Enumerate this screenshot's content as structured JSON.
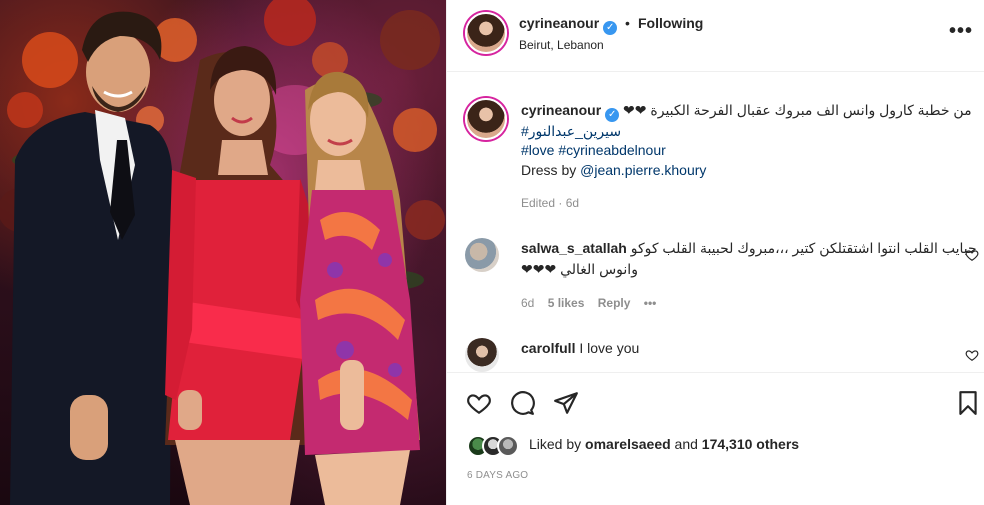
{
  "post": {
    "author": {
      "username": "cyrineanour",
      "location": "Beirut, Lebanon",
      "follow_status": "Following",
      "dot": "•"
    },
    "more_icon": "•••",
    "caption": {
      "text": "من خطبة كارول وانس الف مبروك عقبال الفرحة الكبيرة",
      "hearts": "❤❤",
      "hashtag_ar": "#سيرين_عبدالنور",
      "hashtag_love": "#love",
      "hashtag_name": "#cyrineabdelnour",
      "dress_prefix": "Dress by ",
      "dress_mention": "@jean.pierre.khoury",
      "edited": "Edited",
      "dot": "·",
      "age": "6d"
    },
    "comments": [
      {
        "username": "salwa_s_atallah",
        "text_line1": "حبايب القلب انتوا اشتقتلكن كتير ،،،مبروك لحبيبة القلب كوكو",
        "text_line2": "وانوس الغالي ❤❤❤",
        "age": "6d",
        "likes": "5 likes",
        "reply": "Reply",
        "more": "•••"
      },
      {
        "username": "carolfull",
        "text": "I love you"
      }
    ],
    "liked_by": {
      "prefix": "Liked by ",
      "user": "omarelsaeed",
      "middle": " and ",
      "count": "174,310 others"
    },
    "time_ago": "6 DAYS AGO"
  },
  "icons": {
    "heart": "heart-icon",
    "comment": "comment-icon",
    "share": "paper-plane-icon",
    "save": "bookmark-icon"
  },
  "colors": {
    "link": "#00376b",
    "verified": "#3897f0",
    "muted": "#8e8e8e",
    "text": "#262626",
    "story_ring": "#d6249f"
  }
}
